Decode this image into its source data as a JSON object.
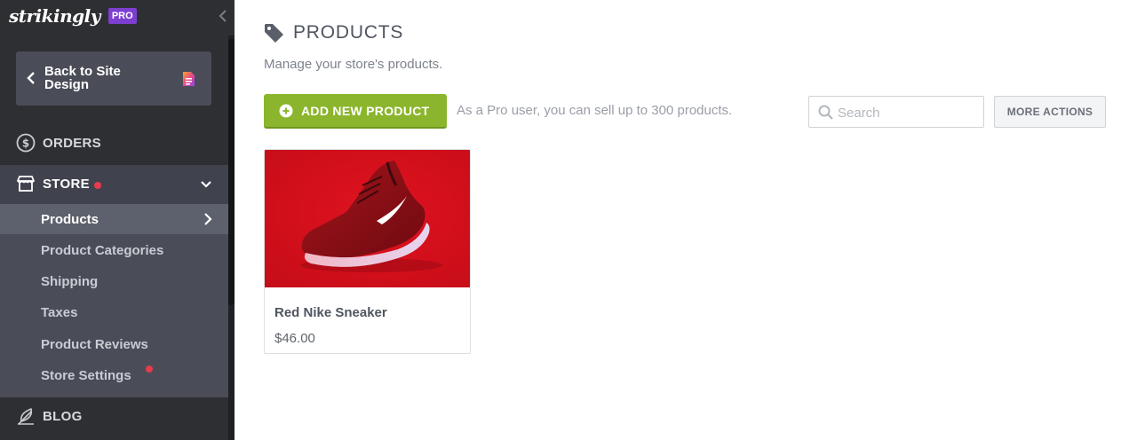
{
  "sidebar": {
    "logo": "strikingly",
    "badge": "PRO",
    "back_button": "Back to Site Design",
    "orders_label": "ORDERS",
    "store_label": "STORE",
    "store_items": [
      {
        "label": "Products"
      },
      {
        "label": "Product Categories"
      },
      {
        "label": "Shipping"
      },
      {
        "label": "Taxes"
      },
      {
        "label": "Product Reviews"
      },
      {
        "label": "Store Settings"
      }
    ],
    "blog_label": "BLOG"
  },
  "main": {
    "title": "PRODUCTS",
    "subtitle": "Manage your store's products.",
    "add_button": "ADD NEW PRODUCT",
    "pro_note": "As a Pro user, you can sell up to 300 products.",
    "search_placeholder": "Search",
    "more_actions": "MORE ACTIONS",
    "products": [
      {
        "name": "Red Nike Sneaker",
        "price": "$46.00"
      }
    ]
  },
  "colors": {
    "sidebar_bg": "#2e2f33",
    "pro_purple": "#7d3fd0",
    "add_green": "#8bb52c",
    "notification_red": "#e63c4d",
    "product_red": "#d8121f"
  },
  "icons": [
    "collapse-chevron-icon",
    "back-chevron-icon",
    "document-icon",
    "dollar-circle-icon",
    "storefront-icon",
    "chevron-down-icon",
    "chevron-right-icon",
    "feather-pen-icon",
    "tag-icon",
    "plus-circle-icon",
    "search-icon"
  ]
}
